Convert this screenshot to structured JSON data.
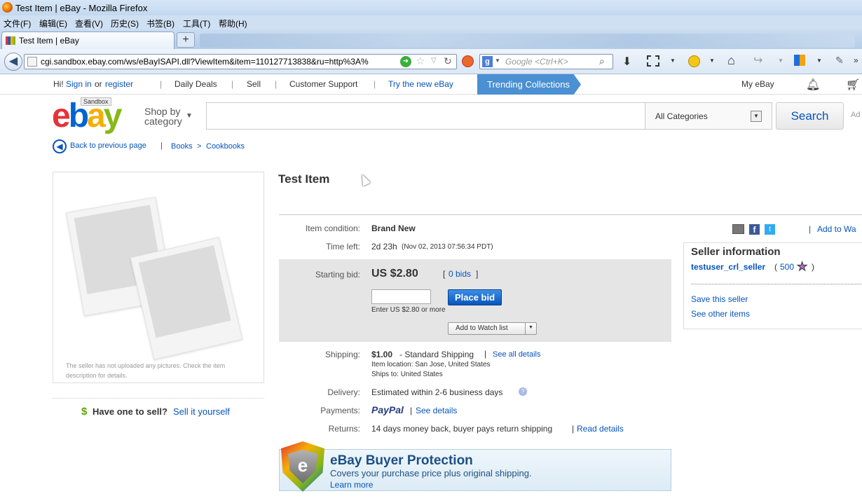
{
  "window": {
    "title": "Test Item | eBay - Mozilla Firefox"
  },
  "menu": [
    "文件(F)",
    "编辑(E)",
    "查看(V)",
    "历史(S)",
    "书签(B)",
    "工具(T)",
    "帮助(H)"
  ],
  "tab": {
    "label": "Test Item | eBay",
    "new_tab": "+"
  },
  "url": "cgi.sandbox.ebay.com/ws/eBayISAPI.dll?ViewItem&item=110127713838&ru=http%3A%",
  "search": {
    "placeholder": "Google <Ctrl+K>"
  },
  "topnav": {
    "hi": "Hi!",
    "sign_in": "Sign in",
    "or": "or",
    "register": "register",
    "daily_deals": "Daily Deals",
    "sell": "Sell",
    "support": "Customer Support",
    "try_new": "Try the new eBay",
    "trending": "Trending Collections",
    "my_ebay": "My eBay"
  },
  "header": {
    "sandbox": "Sandbox",
    "shop_by": "Shop by",
    "category": "category",
    "all_categories": "All Categories",
    "search_button": "Search",
    "ad": "Ad"
  },
  "breadcrumb": {
    "back": "Back to previous page",
    "separator": "|",
    "books": "Books",
    "arrow": ">",
    "cookbooks": "Cookbooks"
  },
  "item": {
    "title": "Test Item",
    "no_pictures": "The seller has not uploaded any pictures. Check the item description for details.",
    "condition_label": "Item condition:",
    "condition": "Brand New",
    "time_left_label": "Time left:",
    "time_left": "2d 23h",
    "time_end": "(Nov 02, 2013 07:56:34 PDT)",
    "starting_bid_label": "Starting bid:",
    "starting_bid": "US $2.80",
    "bids_open": "[",
    "bids": "0 bids",
    "bids_close": "]",
    "place_bid": "Place bid",
    "enter_hint": "Enter US $2.80 or more",
    "watch": "Add to Watch list",
    "shipping_label": "Shipping:",
    "shipping_cost": "$1.00",
    "shipping_method": "- Standard Shipping",
    "see_all_details": "See all details",
    "item_location": "Item location: San Jose, United States",
    "ships_to": "Ships to: United States",
    "delivery_label": "Delivery:",
    "delivery": "Estimated within 2-6 business days",
    "payments_label": "Payments:",
    "paypal": "PayPal",
    "see_details": "See details",
    "returns_label": "Returns:",
    "returns": "14 days money back, buyer pays return shipping",
    "read_details": "Read details"
  },
  "sell": {
    "dollar": "$",
    "have_one": "Have one to sell?",
    "sell_it": "Sell it yourself"
  },
  "seller": {
    "heading": "Seller information",
    "name": "testuser_crl_seller",
    "feedback_open": "(",
    "score": "500",
    "feedback_close": ")",
    "save": "Save this seller",
    "other": "See other items",
    "add_to_watch": "Add to Wa"
  },
  "protection": {
    "title": "eBay Buyer Protection",
    "line": "Covers your purchase price plus original shipping.",
    "learn": "Learn more"
  },
  "colors": {
    "accent": "#0654ba",
    "trending_bg": "#4a90d2",
    "bid_area": "#e5e5e5"
  }
}
